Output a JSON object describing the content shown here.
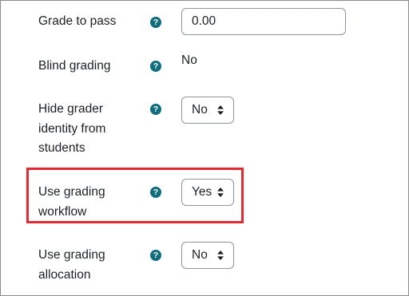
{
  "fields": {
    "grade_to_pass": {
      "label": "Grade to pass",
      "value": "0.00"
    },
    "blind_grading": {
      "label": "Blind grading",
      "value": "No"
    },
    "hide_grader": {
      "label_lines": [
        "Hide grader",
        "identity from",
        "students"
      ],
      "value": "No"
    },
    "grading_workflow": {
      "label_lines": [
        "Use grading",
        "workflow"
      ],
      "value": "Yes"
    },
    "grading_allocation": {
      "label_lines": [
        "Use grading",
        "allocation"
      ],
      "value": "No"
    }
  },
  "help_icon_glyph": "?",
  "colors": {
    "help_icon": "#0f6e7e",
    "highlight_border": "#e32832",
    "text": "#1d2125",
    "input_border": "#8f959e"
  },
  "icons": {
    "help": "question-circle",
    "select_caret": "up-down-arrows"
  }
}
